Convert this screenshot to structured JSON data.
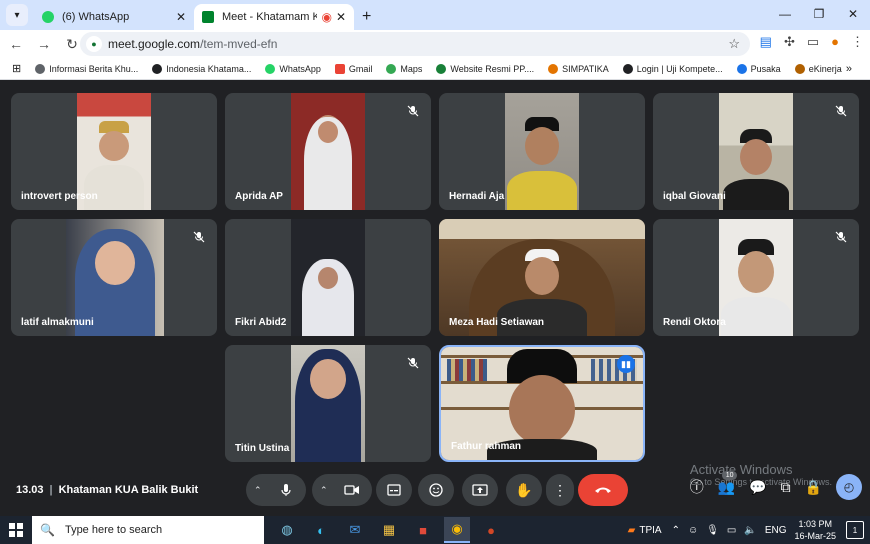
{
  "browser": {
    "tabs": [
      {
        "title": "(6) WhatsApp",
        "icon": "whatsapp-icon",
        "color": "#25d366"
      },
      {
        "title": "Meet - Khatamam KUA Bali",
        "icon": "meet-icon",
        "color": "#00832d"
      }
    ],
    "url_host": "meet.google.com",
    "url_path": "/tem-mved-efn",
    "bookmarks": [
      {
        "label": "Informasi Berita Khu...",
        "color": "#5f6368"
      },
      {
        "label": "Indonesia Khatama...",
        "color": "#202124"
      },
      {
        "label": "WhatsApp",
        "color": "#25d366"
      },
      {
        "label": "Gmail",
        "color": "#ea4335"
      },
      {
        "label": "Maps",
        "color": "#34a853"
      },
      {
        "label": "Website Resmi PP....",
        "color": "#188038"
      },
      {
        "label": "SIMPATIKA",
        "color": "#e37400"
      },
      {
        "label": "Login | Uji Kompete...",
        "color": "#202124"
      },
      {
        "label": "Pusaka",
        "color": "#1a73e8"
      },
      {
        "label": "eKinerja",
        "color": "#b06000"
      }
    ]
  },
  "participants": [
    {
      "name": "introvert person",
      "muted": false
    },
    {
      "name": "Aprida AP",
      "muted": true
    },
    {
      "name": "Hernadi Aja",
      "muted": false
    },
    {
      "name": "iqbal Giovani",
      "muted": true
    },
    {
      "name": "latif almakmuni",
      "muted": true
    },
    {
      "name": "Fikri Abid2",
      "muted": false
    },
    {
      "name": "Meza Hadi Setiawan",
      "muted": false
    },
    {
      "name": "Rendi Oktora",
      "muted": true
    },
    {
      "name": "Titin Ustina",
      "muted": true
    },
    {
      "name": "Fathur rahman",
      "muted": false,
      "speaking": true
    }
  ],
  "meeting": {
    "time": "13.03",
    "title": "Khataman KUA Balik Bukit",
    "people_count": "10"
  },
  "watermark": {
    "line1": "Activate Windows",
    "line2": "Go to Settings to activate Windows."
  },
  "taskbar": {
    "search_placeholder": "Type here to search",
    "weather": "TPIA",
    "language": "ENG",
    "time": "1:03 PM",
    "date": "16-Mar-25",
    "notifications": "1"
  }
}
